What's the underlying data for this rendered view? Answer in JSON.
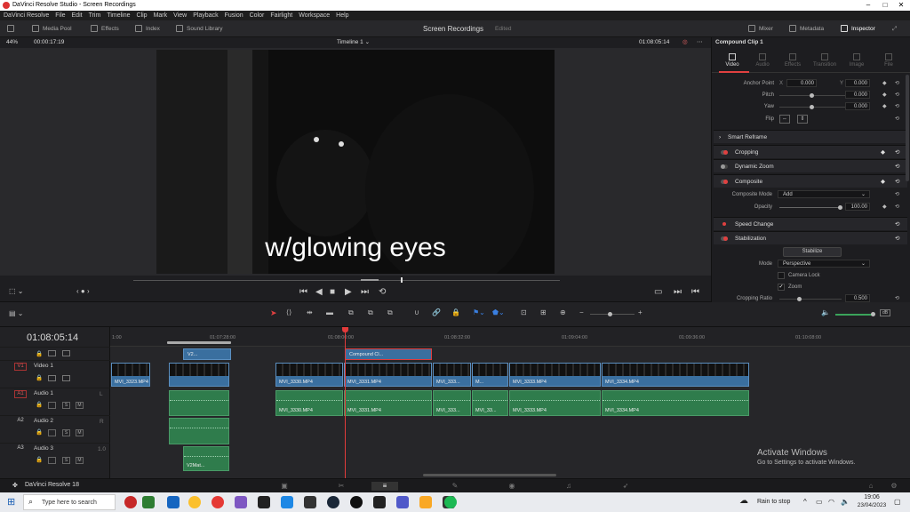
{
  "window": {
    "title": "DaVinci Resolve Studio - Screen Recordings"
  },
  "menu": [
    "DaVinci Resolve",
    "File",
    "Edit",
    "Trim",
    "Timeline",
    "Clip",
    "Mark",
    "View",
    "Playback",
    "Fusion",
    "Color",
    "Fairlight",
    "Workspace",
    "Help"
  ],
  "toolbar": {
    "media_pool": "Media Pool",
    "effects": "Effects",
    "index": "Index",
    "sound_library": "Sound Library",
    "project": "Screen Recordings",
    "edited": "Edited",
    "mixer": "Mixer",
    "metadata": "Metadata",
    "inspector": "Inspector"
  },
  "viewer": {
    "zoom": "44%",
    "timecode": "00:00:17:19",
    "timeline_name": "Timeline 1",
    "current_tc": "01:08:05:14",
    "subtitle": "w/glowing eyes"
  },
  "inspector": {
    "clip_name": "Compound Clip 1",
    "tabs": [
      "Video",
      "Audio",
      "Effects",
      "Transition",
      "Image",
      "File"
    ],
    "anchor_label": "Anchor Point",
    "anchor_x_label": "X",
    "anchor_x": "0.000",
    "anchor_y_label": "Y",
    "anchor_y": "0.000",
    "pitch_label": "Pitch",
    "pitch": "0.000",
    "yaw_label": "Yaw",
    "yaw": "0.000",
    "flip_label": "Flip",
    "sections": {
      "smart_reframe": "Smart Reframe",
      "cropping": "Cropping",
      "dynamic_zoom": "Dynamic Zoom",
      "composite": "Composite",
      "speed_change": "Speed Change",
      "stabilization": "Stabilization"
    },
    "composite_mode_label": "Composite Mode",
    "composite_mode": "Add",
    "opacity_label": "Opacity",
    "opacity": "100.00",
    "stabilize_button": "Stabilize",
    "mode_label": "Mode",
    "mode": "Perspective",
    "camera_lock": "Camera Lock",
    "zoom": "Zoom",
    "cropping_ratio_label": "Cropping Ratio",
    "cropping_ratio": "0.500"
  },
  "timeline": {
    "timecode": "01:08:05:14",
    "ruler": [
      "1:00",
      "01:07:28:00",
      "01:08:00:00",
      "01:08:32:00",
      "01:09:04:00",
      "01:09:36:00",
      "01:10:08:00"
    ],
    "tracks": [
      {
        "tag": "V1",
        "name": "Video 1",
        "extra": ""
      },
      {
        "tag": "A1",
        "name": "Audio 1",
        "extra": "L"
      },
      {
        "tag": "A2",
        "name": "Audio 2",
        "extra": "R"
      },
      {
        "tag": "A3",
        "name": "Audio 3",
        "extra": "1.0"
      }
    ],
    "clips": {
      "v2_a": "V2...",
      "compound": "Compound Cl...",
      "v_3323": "MVI_3323.MP4",
      "v_3330": "MVI_3330.MP4",
      "v_3331": "MVI_3331.MP4",
      "v_333a": "MVI_333...",
      "v_m": "M...",
      "v_3333": "MVI_3333.MP4",
      "v_3334": "MVI_3334.MP4",
      "a_3330": "MVI_3330.MP4",
      "a_3331": "MVI_3331.MP4",
      "a_333a": "MVI_333...",
      "a_333b": "MVI_33...",
      "a_3333": "MVI_3333.MP4",
      "a_3334": "MVI_3334.MP4",
      "a3": "V2Mat..."
    },
    "track_buttons": {
      "s": "S",
      "m": "M"
    }
  },
  "bottom": {
    "app_name": "DaVinci Resolve 18"
  },
  "watermark": {
    "line1": "Activate Windows",
    "line2": "Go to Settings to activate Windows."
  },
  "taskbar": {
    "search": "Type here to search",
    "weather": "Rain to stop",
    "time": "19:06",
    "date": "23/04/2023"
  }
}
